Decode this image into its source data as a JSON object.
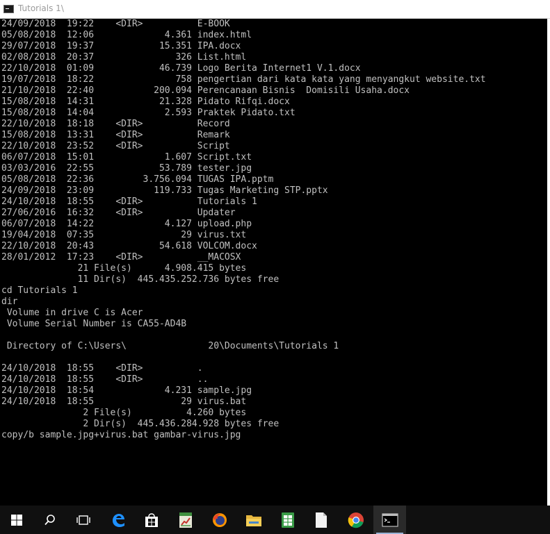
{
  "window": {
    "title": "Tutorials 1\\"
  },
  "console": {
    "lines": [
      "24/09/2018  19:22    <DIR>          E-BOOK",
      "05/08/2018  12:06             4.361 index.html",
      "29/07/2018  19:37            15.351 IPA.docx",
      "02/08/2018  20:37               326 List.html",
      "22/10/2018  01:09            46.739 Logo Berita Internet1 V.1.docx",
      "19/07/2018  18:22               758 pengertian dari kata kata yang menyangkut website.txt",
      "21/10/2018  22:40           200.094 Perencanaan Bisnis  Domisili Usaha.docx",
      "15/08/2018  14:31            21.328 Pidato Rifqi.docx",
      "15/08/2018  14:04             2.593 Praktek Pidato.txt",
      "22/10/2018  18:18    <DIR>          Record",
      "15/08/2018  13:31    <DIR>          Remark",
      "22/10/2018  23:52    <DIR>          Script",
      "06/07/2018  15:01             1.607 Script.txt",
      "03/03/2016  22:55            53.789 tester.jpg",
      "05/08/2018  22:36         3.756.094 TUGAS IPA.pptm",
      "24/09/2018  23:09           119.733 Tugas Marketing STP.pptx",
      "24/10/2018  18:55    <DIR>          Tutorials 1",
      "27/06/2016  16:32    <DIR>          Updater",
      "06/07/2018  14:22             4.127 upload.php",
      "19/04/2018  07:35                29 virus.txt",
      "22/10/2018  20:43            54.618 VOLCOM.docx",
      "28/01/2012  17:23    <DIR>          __MACOSX",
      "              21 File(s)      4.908.415 bytes",
      "              11 Dir(s)  445.435.252.736 bytes free",
      "cd Tutorials 1",
      "dir",
      " Volume in drive C is Acer",
      " Volume Serial Number is CA55-AD4B",
      "",
      " Directory of C:\\Users\\               20\\Documents\\Tutorials 1",
      "",
      "24/10/2018  18:55    <DIR>          .",
      "24/10/2018  18:55    <DIR>          ..",
      "24/10/2018  18:54             4.231 sample.jpg",
      "24/10/2018  18:55                29 virus.bat",
      "               2 File(s)          4.260 bytes",
      "               2 Dir(s)  445.436.284.928 bytes free",
      "copy/b sample.jpg+virus.bat gambar-virus.jpg"
    ]
  },
  "taskbar": {
    "items": [
      {
        "name": "start-button",
        "icon": "windows-logo-icon"
      },
      {
        "name": "search-button",
        "icon": "search-icon"
      },
      {
        "name": "task-view-button",
        "icon": "task-view-icon"
      },
      {
        "name": "edge-button",
        "icon": "edge-icon"
      },
      {
        "name": "store-button",
        "icon": "store-icon"
      },
      {
        "name": "chart-app-button",
        "icon": "chart-app-icon"
      },
      {
        "name": "firefox-button",
        "icon": "firefox-icon"
      },
      {
        "name": "file-explorer-button",
        "icon": "folder-icon"
      },
      {
        "name": "spreadsheet-app-button",
        "icon": "spreadsheet-icon"
      },
      {
        "name": "document-button",
        "icon": "document-icon"
      },
      {
        "name": "chrome-button",
        "icon": "chrome-icon"
      },
      {
        "name": "command-prompt-button",
        "icon": "command-prompt-icon"
      }
    ]
  },
  "colors": {
    "console_bg": "#000000",
    "console_text": "#c0c0c0",
    "taskbar_bg": "#101010"
  }
}
